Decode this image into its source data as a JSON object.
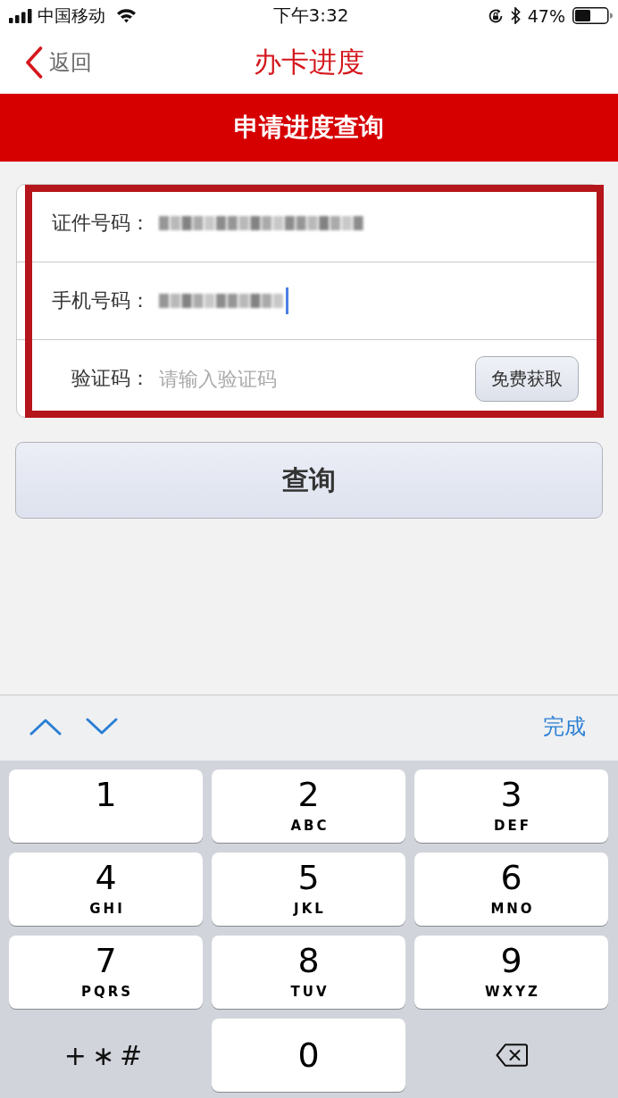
{
  "status_bar": {
    "carrier": "中国移动",
    "time": "下午3:32",
    "battery": "47%"
  },
  "nav": {
    "back": "返回",
    "title": "办卡进度"
  },
  "banner": {
    "title": "申请进度查询"
  },
  "form": {
    "highlighted": true,
    "fields": [
      {
        "kind": "id_number",
        "label": "证件号码：",
        "focused": false
      },
      {
        "kind": "phone",
        "label": "手机号码：",
        "focused": true
      },
      {
        "kind": "code",
        "label": "验证码：",
        "placeholder": "请输入验证码",
        "action": "免费获取",
        "focused": false
      }
    ]
  },
  "query_button": "查询",
  "keyboard": {
    "done": "完成",
    "keys": [
      {
        "kind": "digit",
        "digit": "1"
      },
      {
        "kind": "digit",
        "digit": "2",
        "letters": "ABC"
      },
      {
        "kind": "digit",
        "digit": "3",
        "letters": "DEF"
      },
      {
        "kind": "digit",
        "digit": "4",
        "letters": "GHI"
      },
      {
        "kind": "digit",
        "digit": "5",
        "letters": "JKL"
      },
      {
        "kind": "digit",
        "digit": "6",
        "letters": "MNO"
      },
      {
        "kind": "digit",
        "digit": "7",
        "letters": "PQRS"
      },
      {
        "kind": "digit",
        "digit": "8",
        "letters": "TUV"
      },
      {
        "kind": "digit",
        "digit": "9",
        "letters": "WXYZ"
      },
      {
        "kind": "symbols",
        "label": "+∗#"
      },
      {
        "kind": "solo",
        "digit": "0"
      },
      {
        "kind": "delete"
      }
    ]
  }
}
